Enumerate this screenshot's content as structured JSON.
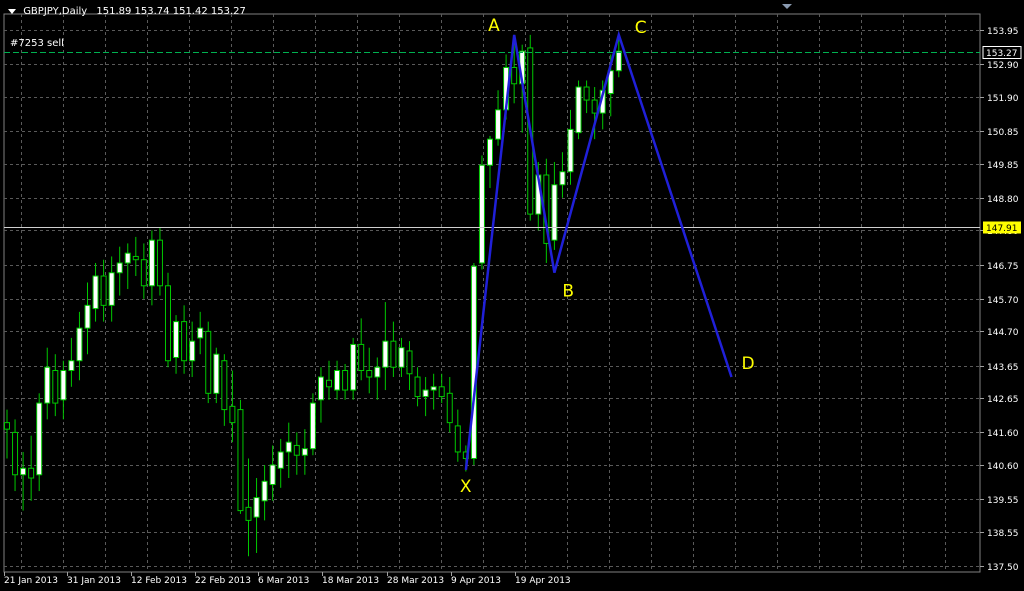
{
  "header": {
    "symbol_timeframe": "GBPJPY,Daily",
    "ohlc": "151.89 153.74 151.42 153.27"
  },
  "order_line": {
    "label": "#7253 sell",
    "price": 153.27,
    "color": "#00b050"
  },
  "crosshair_price_label": "147.91",
  "colors": {
    "background": "#000000",
    "grid": "#5a5a5a",
    "bull_candle": "#ffffff",
    "bear_candle": "#000000",
    "wick": "#00c800",
    "pattern_line": "#2020d8",
    "pattern_label": "#ffff00",
    "axis_text": "#ffffff",
    "current_price_box": "#000000",
    "crosshair_box": "#ffff00"
  },
  "chart_data": {
    "type": "candlestick",
    "title": "GBPJPY,Daily",
    "ylim": [
      137.3,
      154.6
    ],
    "y_ticks": [
      137.5,
      138.55,
      139.55,
      140.6,
      141.6,
      142.65,
      143.65,
      144.7,
      145.7,
      146.75,
      147.8,
      148.8,
      149.85,
      150.85,
      151.9,
      152.9,
      153.95
    ],
    "y_tick_labels": [
      "137.50",
      "138.55",
      "139.55",
      "140.60",
      "141.60",
      "142.65",
      "143.65",
      "144.70",
      "145.70",
      "146.75",
      "147.80",
      "148.80",
      "149.85",
      "150.85",
      "151.90",
      "152.90",
      "153.95"
    ],
    "x_tick_labels": [
      "21 Jan 2013",
      "31 Jan 2013",
      "12 Feb 2013",
      "22 Feb 2013",
      "6 Mar 2013",
      "18 Mar 2013",
      "28 Mar 2013",
      "9 Apr 2013",
      "19 Apr 2013"
    ],
    "grid": true,
    "current_price": 153.27,
    "candles": [
      {
        "o": 141.9,
        "h": 142.3,
        "l": 140.8,
        "c": 141.7
      },
      {
        "o": 141.6,
        "h": 142.0,
        "l": 139.8,
        "c": 140.3
      },
      {
        "o": 140.3,
        "h": 141.0,
        "l": 139.2,
        "c": 140.5
      },
      {
        "o": 140.5,
        "h": 141.5,
        "l": 139.5,
        "c": 140.2
      },
      {
        "o": 140.3,
        "h": 142.8,
        "l": 139.8,
        "c": 142.5
      },
      {
        "o": 142.5,
        "h": 144.2,
        "l": 142.0,
        "c": 143.6
      },
      {
        "o": 143.5,
        "h": 144.0,
        "l": 142.1,
        "c": 142.5
      },
      {
        "o": 142.6,
        "h": 143.8,
        "l": 142.0,
        "c": 143.5
      },
      {
        "o": 143.5,
        "h": 144.5,
        "l": 143.0,
        "c": 143.8
      },
      {
        "o": 143.8,
        "h": 145.3,
        "l": 143.2,
        "c": 144.8
      },
      {
        "o": 144.8,
        "h": 146.2,
        "l": 144.0,
        "c": 145.5
      },
      {
        "o": 145.4,
        "h": 146.8,
        "l": 145.0,
        "c": 146.4
      },
      {
        "o": 146.4,
        "h": 146.9,
        "l": 145.0,
        "c": 145.5
      },
      {
        "o": 145.5,
        "h": 147.0,
        "l": 145.0,
        "c": 146.5
      },
      {
        "o": 146.5,
        "h": 147.3,
        "l": 145.8,
        "c": 146.8
      },
      {
        "o": 146.8,
        "h": 147.4,
        "l": 146.0,
        "c": 147.1
      },
      {
        "o": 147.0,
        "h": 147.6,
        "l": 146.4,
        "c": 146.9
      },
      {
        "o": 146.9,
        "h": 147.4,
        "l": 145.7,
        "c": 146.1
      },
      {
        "o": 146.1,
        "h": 147.8,
        "l": 145.5,
        "c": 147.5
      },
      {
        "o": 147.5,
        "h": 147.9,
        "l": 145.8,
        "c": 146.1
      },
      {
        "o": 146.1,
        "h": 146.5,
        "l": 143.6,
        "c": 143.8
      },
      {
        "o": 143.9,
        "h": 145.2,
        "l": 143.4,
        "c": 145.0
      },
      {
        "o": 145.0,
        "h": 145.5,
        "l": 143.4,
        "c": 143.8
      },
      {
        "o": 143.8,
        "h": 145.0,
        "l": 143.3,
        "c": 144.4
      },
      {
        "o": 144.5,
        "h": 145.3,
        "l": 144.0,
        "c": 144.8
      },
      {
        "o": 144.7,
        "h": 145.0,
        "l": 142.5,
        "c": 142.8
      },
      {
        "o": 142.8,
        "h": 144.2,
        "l": 142.5,
        "c": 144.0
      },
      {
        "o": 143.8,
        "h": 144.0,
        "l": 141.8,
        "c": 142.3
      },
      {
        "o": 142.4,
        "h": 143.5,
        "l": 141.3,
        "c": 141.9
      },
      {
        "o": 142.3,
        "h": 142.6,
        "l": 139.1,
        "c": 139.2
      },
      {
        "o": 139.3,
        "h": 140.8,
        "l": 137.8,
        "c": 138.9
      },
      {
        "o": 139.0,
        "h": 140.2,
        "l": 137.9,
        "c": 139.6
      },
      {
        "o": 139.5,
        "h": 140.6,
        "l": 138.9,
        "c": 140.1
      },
      {
        "o": 140.0,
        "h": 141.2,
        "l": 139.5,
        "c": 140.6
      },
      {
        "o": 140.5,
        "h": 141.4,
        "l": 139.9,
        "c": 141.0
      },
      {
        "o": 141.0,
        "h": 141.9,
        "l": 140.2,
        "c": 141.3
      },
      {
        "o": 141.2,
        "h": 141.6,
        "l": 140.3,
        "c": 140.9
      },
      {
        "o": 140.9,
        "h": 141.7,
        "l": 140.3,
        "c": 141.1
      },
      {
        "o": 141.1,
        "h": 142.8,
        "l": 140.9,
        "c": 142.5
      },
      {
        "o": 142.6,
        "h": 143.6,
        "l": 141.9,
        "c": 143.3
      },
      {
        "o": 143.2,
        "h": 143.8,
        "l": 142.6,
        "c": 143.0
      },
      {
        "o": 142.9,
        "h": 143.8,
        "l": 142.6,
        "c": 143.5
      },
      {
        "o": 143.5,
        "h": 143.7,
        "l": 142.6,
        "c": 142.9
      },
      {
        "o": 142.9,
        "h": 144.5,
        "l": 142.6,
        "c": 144.3
      },
      {
        "o": 144.3,
        "h": 145.1,
        "l": 143.2,
        "c": 143.5
      },
      {
        "o": 143.5,
        "h": 144.2,
        "l": 142.8,
        "c": 143.3
      },
      {
        "o": 143.3,
        "h": 143.9,
        "l": 142.6,
        "c": 143.6
      },
      {
        "o": 143.6,
        "h": 145.6,
        "l": 142.9,
        "c": 144.4
      },
      {
        "o": 144.4,
        "h": 145.0,
        "l": 143.3,
        "c": 143.6
      },
      {
        "o": 143.6,
        "h": 144.5,
        "l": 143.3,
        "c": 144.2
      },
      {
        "o": 144.1,
        "h": 144.4,
        "l": 142.9,
        "c": 143.4
      },
      {
        "o": 143.3,
        "h": 143.6,
        "l": 142.4,
        "c": 142.7
      },
      {
        "o": 142.7,
        "h": 143.3,
        "l": 142.1,
        "c": 142.9
      },
      {
        "o": 142.9,
        "h": 143.4,
        "l": 142.3,
        "c": 143.0
      },
      {
        "o": 143.0,
        "h": 143.4,
        "l": 142.5,
        "c": 142.7
      },
      {
        "o": 142.8,
        "h": 143.3,
        "l": 141.6,
        "c": 141.9
      },
      {
        "o": 141.8,
        "h": 142.3,
        "l": 140.7,
        "c": 141.0
      },
      {
        "o": 141.0,
        "h": 141.2,
        "l": 140.4,
        "c": 140.8
      },
      {
        "o": 140.8,
        "h": 146.8,
        "l": 140.6,
        "c": 146.7
      },
      {
        "o": 146.8,
        "h": 150.1,
        "l": 146.6,
        "c": 149.8
      },
      {
        "o": 149.8,
        "h": 150.7,
        "l": 149.1,
        "c": 150.6
      },
      {
        "o": 150.6,
        "h": 152.1,
        "l": 150.4,
        "c": 151.5
      },
      {
        "o": 151.5,
        "h": 153.2,
        "l": 151.2,
        "c": 152.8
      },
      {
        "o": 152.8,
        "h": 153.8,
        "l": 151.7,
        "c": 152.3
      },
      {
        "o": 152.3,
        "h": 153.5,
        "l": 150.8,
        "c": 153.3
      },
      {
        "o": 153.4,
        "h": 153.8,
        "l": 148.1,
        "c": 148.3
      },
      {
        "o": 148.3,
        "h": 149.9,
        "l": 147.8,
        "c": 149.5
      },
      {
        "o": 149.5,
        "h": 150.0,
        "l": 146.8,
        "c": 147.4
      },
      {
        "o": 147.5,
        "h": 149.9,
        "l": 147.2,
        "c": 149.2
      },
      {
        "o": 149.2,
        "h": 150.2,
        "l": 148.8,
        "c": 149.6
      },
      {
        "o": 149.6,
        "h": 151.5,
        "l": 149.2,
        "c": 150.9
      },
      {
        "o": 150.8,
        "h": 152.4,
        "l": 150.6,
        "c": 152.2
      },
      {
        "o": 152.2,
        "h": 152.4,
        "l": 151.4,
        "c": 151.8
      },
      {
        "o": 151.8,
        "h": 152.2,
        "l": 150.6,
        "c": 151.4
      },
      {
        "o": 151.4,
        "h": 152.4,
        "l": 150.9,
        "c": 152.1
      },
      {
        "o": 152.0,
        "h": 153.2,
        "l": 151.3,
        "c": 152.7
      },
      {
        "o": 152.7,
        "h": 153.8,
        "l": 152.5,
        "c": 153.3
      }
    ],
    "pattern": {
      "points": [
        {
          "label": "X",
          "index": 57,
          "price": 140.45
        },
        {
          "label": "A",
          "index": 63,
          "price": 153.8
        },
        {
          "label": "B",
          "index": 68,
          "price": 146.5
        },
        {
          "label": "C",
          "index": 76,
          "price": 153.8
        },
        {
          "label": "D",
          "index": 90,
          "price": 143.3
        }
      ]
    }
  }
}
